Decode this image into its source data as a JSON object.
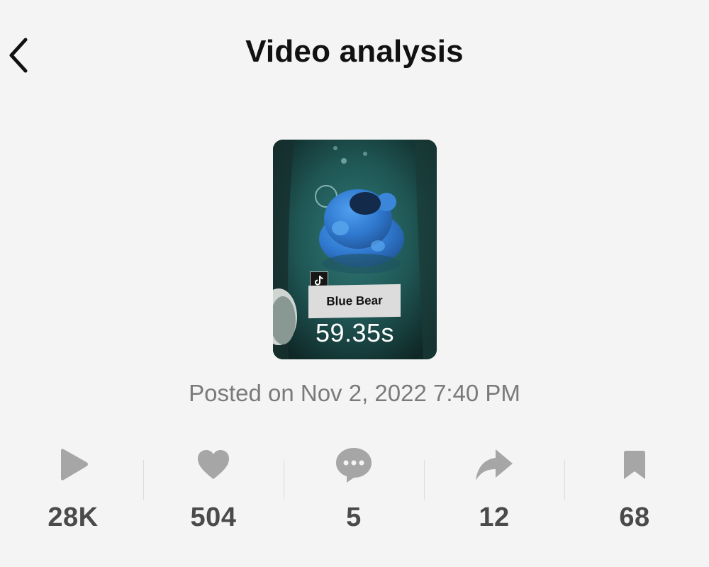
{
  "header": {
    "title": "Video analysis",
    "back_icon": "chevron-left-icon"
  },
  "video": {
    "label": "Blue Bear",
    "duration": "59.35s",
    "badge_icon": "tiktok-icon",
    "posted": "Posted on Nov 2, 2022 7:40 PM"
  },
  "stats": [
    {
      "icon": "play-icon",
      "value": "28K"
    },
    {
      "icon": "heart-icon",
      "value": "504"
    },
    {
      "icon": "comment-icon",
      "value": "5"
    },
    {
      "icon": "share-icon",
      "value": "12"
    },
    {
      "icon": "bookmark-icon",
      "value": "68"
    }
  ],
  "colors": {
    "background": "#f4f4f4",
    "icon_gray": "#a6a6a6",
    "value_gray": "#4a4a4a",
    "posted_gray": "#7a7a7a"
  }
}
